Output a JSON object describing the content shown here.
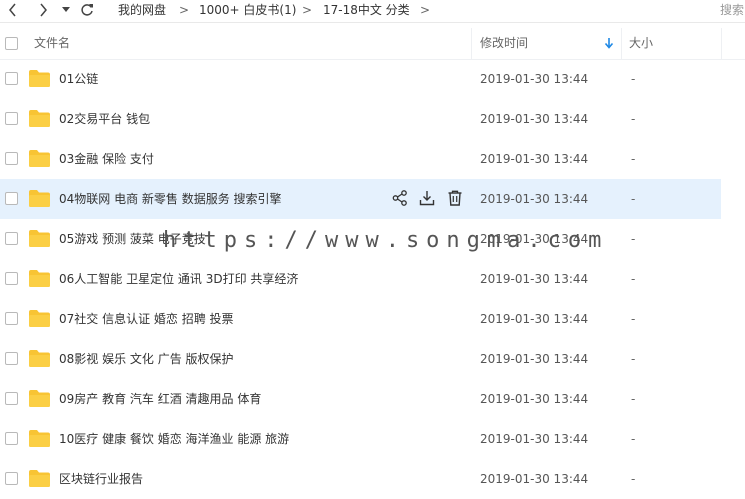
{
  "nav": {
    "back_icon": "chevron-left-icon",
    "forward_icon": "chevron-right-icon",
    "history_icon": "caret-down-icon",
    "refresh_icon": "refresh-icon"
  },
  "breadcrumb": {
    "items": [
      "我的网盘",
      "1000+ 白皮书(1)",
      "17-18中文 分类"
    ],
    "separator": ">"
  },
  "search": {
    "label": "搜索"
  },
  "header": {
    "name": "文件名",
    "modified": "修改时间",
    "sort_icon": "sort-down-arrow-icon",
    "size": "大小"
  },
  "files": [
    {
      "name": "01公链",
      "date": "2019-01-30 13:44",
      "size": "-"
    },
    {
      "name": "02交易平台  钱包",
      "date": "2019-01-30 13:44",
      "size": "-"
    },
    {
      "name": "03金融 保险 支付",
      "date": "2019-01-30 13:44",
      "size": "-"
    },
    {
      "name": "04物联网  电商 新零售 数据服务 搜索引擎",
      "date": "2019-01-30 13:44",
      "size": "-"
    },
    {
      "name": "05游戏 预测  菠菜 电子竞技",
      "date": "2019-01-30 13:44",
      "size": "-"
    },
    {
      "name": "06人工智能 卫星定位 通讯 3D打印 共享经济",
      "date": "2019-01-30 13:44",
      "size": "-"
    },
    {
      "name": "07社交 信息认证 婚恋 招聘 投票",
      "date": "2019-01-30 13:44",
      "size": "-"
    },
    {
      "name": "08影视 娱乐 文化 广告 版权保护",
      "date": "2019-01-30 13:44",
      "size": "-"
    },
    {
      "name": "09房产 教育 汽车 红酒 清趣用品 体育",
      "date": "2019-01-30 13:44",
      "size": "-"
    },
    {
      "name": "10医疗 健康 餐饮  婚恋 海洋渔业  能源 旅游",
      "date": "2019-01-30 13:44",
      "size": "-"
    },
    {
      "name": "区块链行业报告",
      "date": "2019-01-30 13:44",
      "size": "-"
    }
  ],
  "row_actions": {
    "share_icon": "share-icon",
    "download_icon": "download-icon",
    "delete_icon": "trash-icon"
  },
  "watermark": "https://www.songma.com",
  "colors": {
    "hover_row": "#e5f1fd",
    "folder": "#f8c434",
    "accent": "#1e88e5"
  }
}
